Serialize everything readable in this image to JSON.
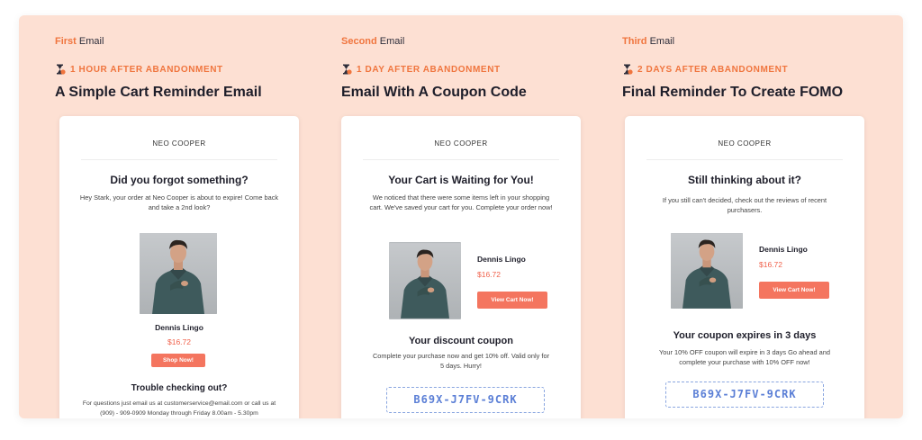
{
  "colors": {
    "panel_bg": "#fde0d3",
    "accent": "#f0753e",
    "button": "#f4755f",
    "price": "#f0614b",
    "coupon_text": "#5b7fd6"
  },
  "columns": [
    {
      "order": "First",
      "email_word": "Email",
      "timing": "1 HOUR AFTER ABANDONMENT",
      "timing_icon": "hourglass-icon",
      "headline": "A Simple Cart Reminder Email",
      "card": {
        "brand": "NEO COOPER",
        "title": "Did you forgot something?",
        "body": "Hey Stark, your order at Neo Cooper is about to expire! Come back and take a 2nd look?",
        "product_name": "Dennis Lingo",
        "product_price": "$16.72",
        "button_label": "Shop Now!",
        "footer_title": "Trouble checking out?",
        "footer_body": "For questions just email us at customerservice@email.com or call us at (909) - 909-0909 Monday through Friday 8.00am - 5.30pm"
      }
    },
    {
      "order": "Second",
      "email_word": "Email",
      "timing": "1 DAY AFTER ABANDONMENT",
      "timing_icon": "hourglass-icon",
      "headline": "Email With A Coupon Code",
      "card": {
        "brand": "NEO COOPER",
        "title": "Your Cart is Waiting for You!",
        "body": "We noticed that there were some items left in your shopping cart. We've saved your cart for you. Complete your order now!",
        "product_name": "Dennis Lingo",
        "product_price": "$16.72",
        "button_label": "View Cart Now!",
        "coupon_title": "Your discount coupon",
        "coupon_body": "Complete your purchase now and get 10% off. Valid only for 5 days. Hurry!",
        "coupon_code": "B69X-J7FV-9CRK"
      }
    },
    {
      "order": "Third",
      "email_word": "Email",
      "timing": "2 DAYS AFTER ABANDONMENT",
      "timing_icon": "hourglass-icon",
      "headline": "Final Reminder To Create FOMO",
      "card": {
        "brand": "NEO COOPER",
        "title": "Still thinking about it?",
        "body": "If you still can't decided, check out the reviews of recent purchasers.",
        "product_name": "Dennis Lingo",
        "product_price": "$16.72",
        "button_label": "View Cart Now!",
        "coupon_title": "Your coupon expires in 3 days",
        "coupon_body": "Your 10% OFF coupon will expire in 3 days Go ahead and complete your purchase with 10% OFF now!",
        "coupon_code": "B69X-J7FV-9CRK"
      }
    }
  ]
}
